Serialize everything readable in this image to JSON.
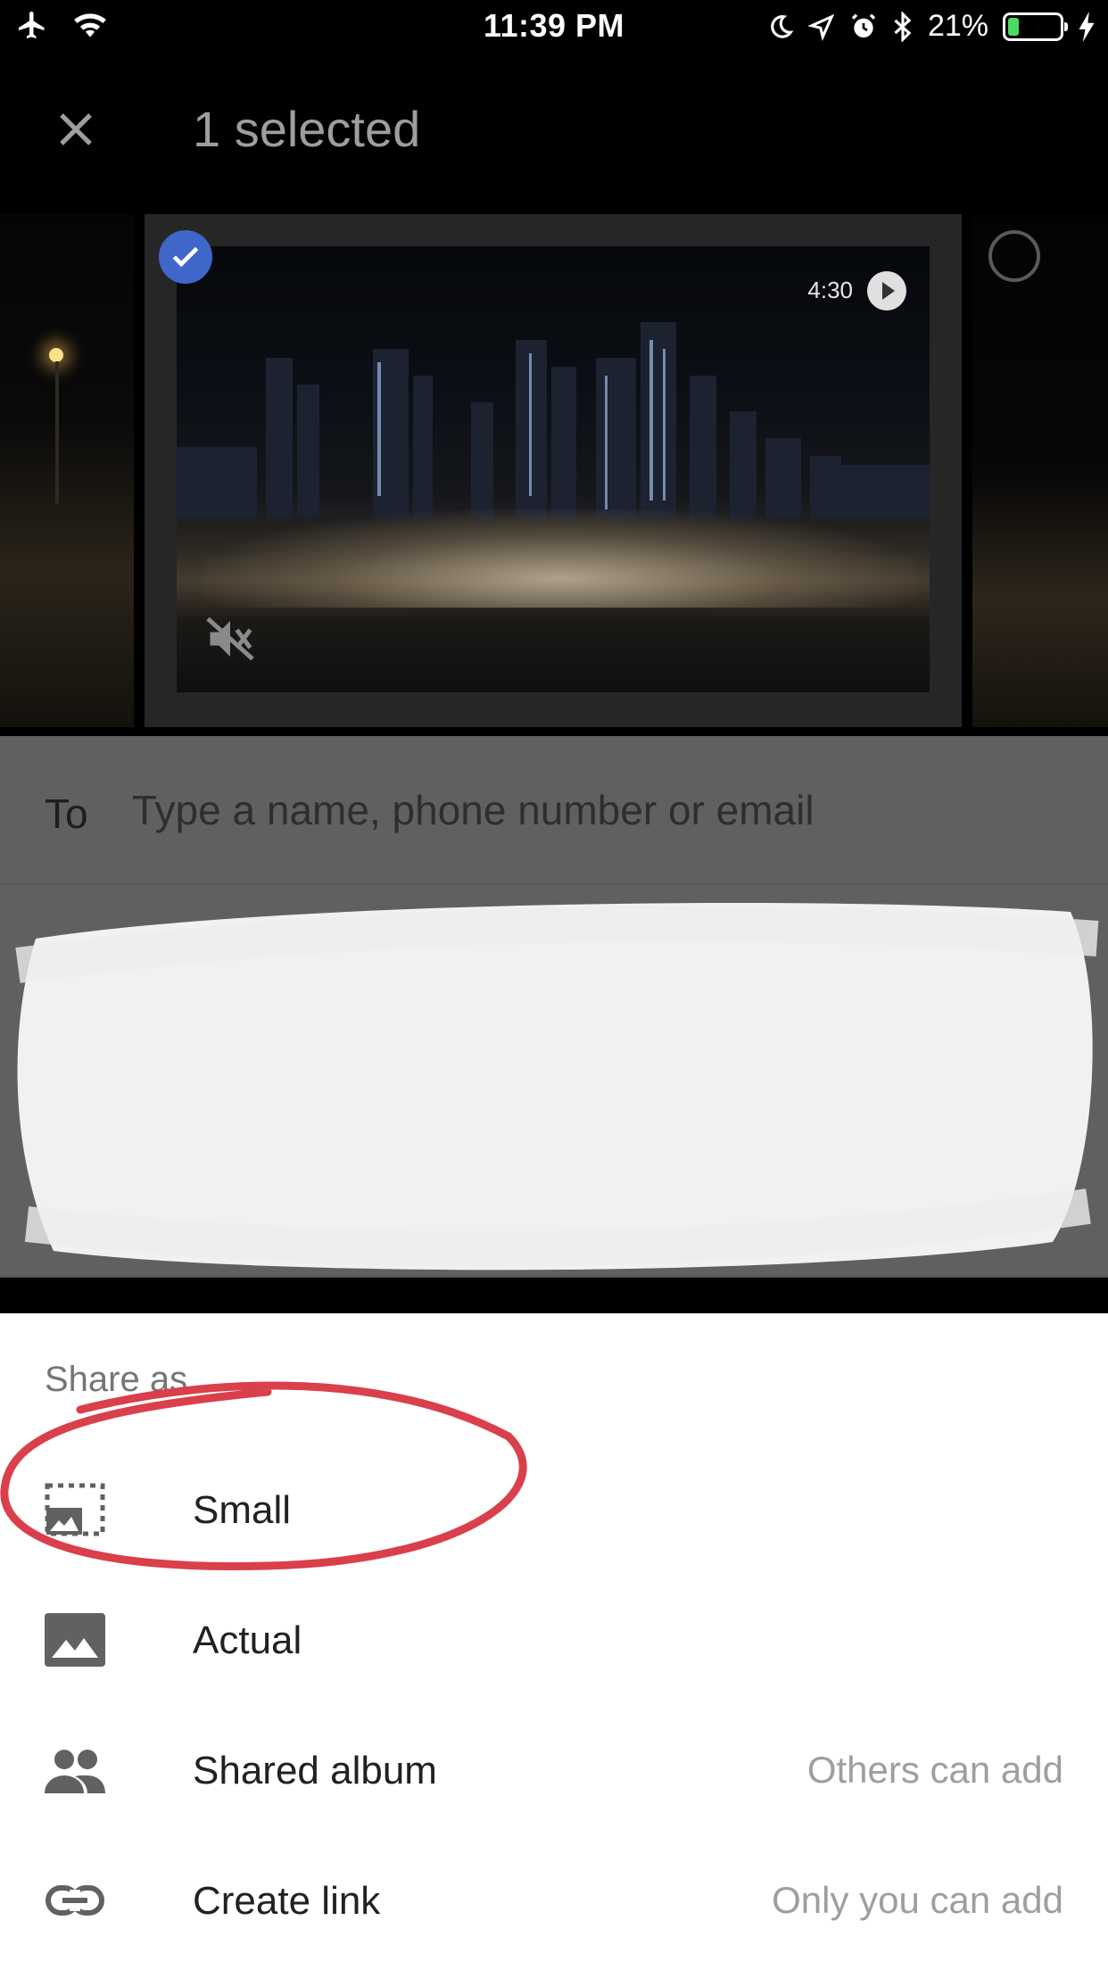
{
  "status_bar": {
    "time": "11:39 PM",
    "battery": "21%",
    "battery_level": 0.21
  },
  "header": {
    "title": "1 selected",
    "close_icon": "close-icon"
  },
  "photos": {
    "selected_video_duration": "4:30"
  },
  "to_field": {
    "label": "To",
    "placeholder": "Type a name, phone number or email"
  },
  "share_sheet": {
    "header": "Share as",
    "options": [
      {
        "label": "Small",
        "icon": "image-small-icon",
        "note": ""
      },
      {
        "label": "Actual",
        "icon": "image-icon",
        "note": ""
      },
      {
        "label": "Shared album",
        "icon": "people-icon",
        "note": "Others can add"
      },
      {
        "label": "Create link",
        "icon": "link-icon",
        "note": "Only you can add"
      }
    ]
  },
  "colors": {
    "accent_check": "#3f66c9",
    "battery_green": "#4cd964",
    "annotation_red": "#d9404b"
  }
}
